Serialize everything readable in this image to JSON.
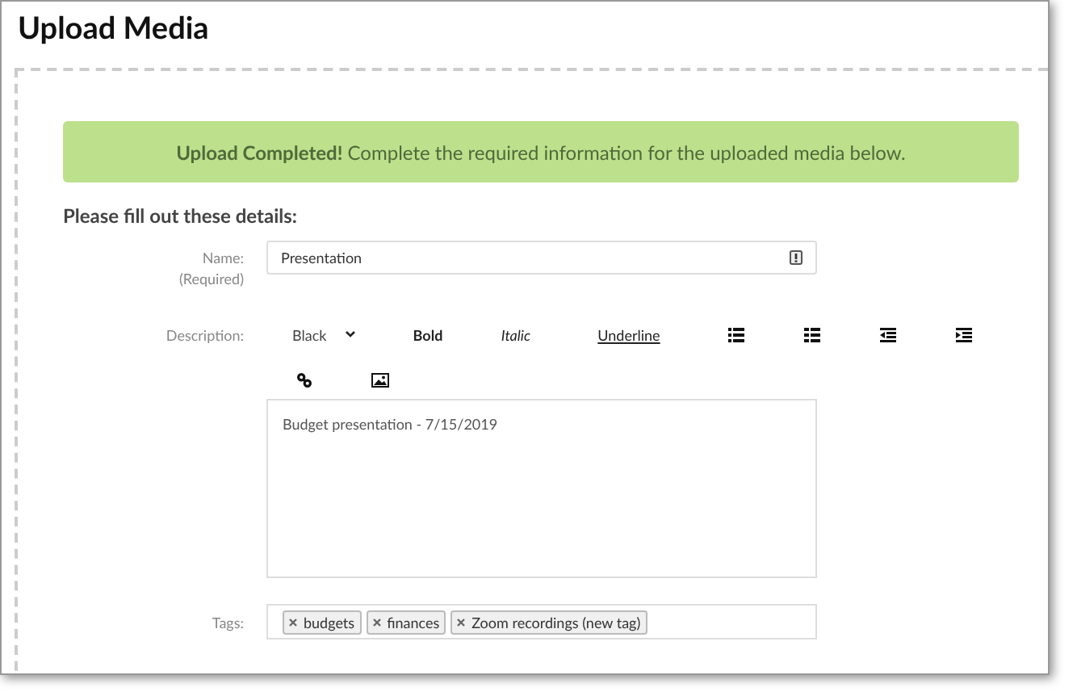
{
  "window": {
    "title": "Upload Media"
  },
  "alert": {
    "text": "**Upload Completed!** Complete the required information for the uploaded media below."
  },
  "form": {
    "heading": "Please fill out these details:",
    "name": {
      "label": "Name:",
      "note": "(Required)",
      "value": "Presentation"
    },
    "description": {
      "label": "Description:",
      "color_dropdown": "Black",
      "format_buttons": [
        {
          "kind": "bold",
          "label": "Bold"
        },
        {
          "kind": "italic",
          "label": "Italic"
        },
        {
          "kind": "underline",
          "label": "Underline"
        }
      ],
      "value": "Budget presentation - 7/15/2019"
    },
    "tags": {
      "label": "Tags:",
      "items": [
        "budgets",
        "finances",
        "Zoom recordings (new tag)"
      ]
    }
  }
}
